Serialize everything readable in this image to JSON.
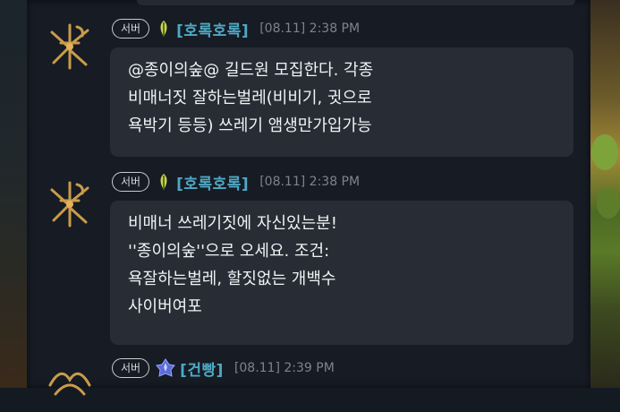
{
  "messages": [
    {
      "badge": "서버",
      "rank_icon": "leaf-rank-icon",
      "sender": "[호록호록]",
      "time": "[08.11] 2:38 PM",
      "lines": [
        "@종이의숲@ 길드원 모집한다.  각종",
        "비매너짓 잘하는벌레(비비기, 귓으로",
        "욕박기 등등) 쓰레기 앰생만가입가능"
      ]
    },
    {
      "badge": "서버",
      "rank_icon": "leaf-rank-icon",
      "sender": "[호록호록]",
      "time": "[08.11] 2:38 PM",
      "lines": [
        "비매너 쓰레기짓에 자신있는분!",
        "''종이의숲''으로 오세요. 조건:",
        "욕잘하는벌레, 할짓없는 개백수",
        "사이버여포"
      ]
    },
    {
      "badge": "서버",
      "rank_icon": "crystal-rank-icon",
      "sender": "[건빵]",
      "time": "[08.11] 2:39 PM"
    }
  ],
  "colors": {
    "panel": "#161b24",
    "bubble": "#272c35",
    "sender": "#4fa8c4",
    "timestamp": "#7d848c",
    "emblem_gold": "#c99b4a"
  }
}
